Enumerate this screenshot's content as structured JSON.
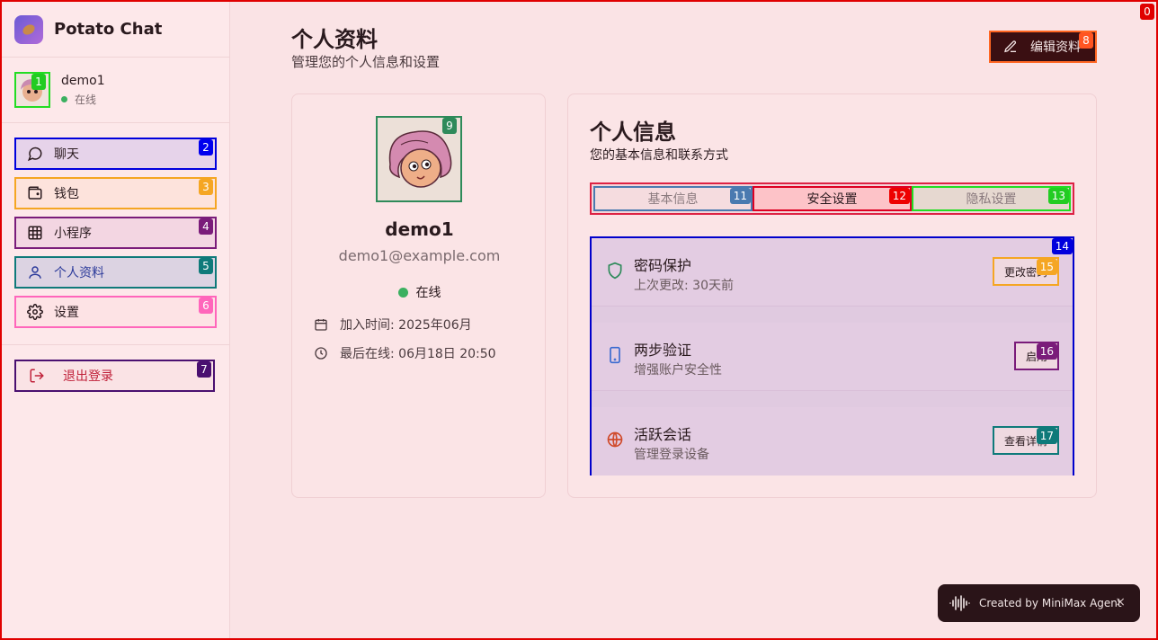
{
  "app": {
    "name": "Potato Chat"
  },
  "sidebar": {
    "user": {
      "name": "demo1",
      "status": "在线"
    },
    "items": [
      {
        "label": "聊天",
        "icon": "chat-bubble-icon"
      },
      {
        "label": "钱包",
        "icon": "wallet-icon"
      },
      {
        "label": "小程序",
        "icon": "grid-icon"
      },
      {
        "label": "个人资料",
        "icon": "user-icon"
      },
      {
        "label": "设置",
        "icon": "gear-icon"
      }
    ],
    "logout_label": "退出登录"
  },
  "header": {
    "title": "个人资料",
    "subtitle": "管理您的个人信息和设置",
    "edit_label": "编辑资料"
  },
  "profile": {
    "name": "demo1",
    "email": "demo1@example.com",
    "status": "在线",
    "joined": "加入时间: 2025年06月",
    "last_online": "最后在线: 06月18日 20:50"
  },
  "info": {
    "title": "个人信息",
    "subtitle": "您的基本信息和联系方式",
    "tabs": [
      "基本信息",
      "安全设置",
      "隐私设置"
    ],
    "active_tab": "安全设置",
    "security_items": [
      {
        "title": "密码保护",
        "desc": "上次更改: 30天前",
        "action": "更改密码",
        "icon": "shield-icon",
        "icon_color": "#2e8a5a"
      },
      {
        "title": "两步验证",
        "desc": "增强账户安全性",
        "action": "启用",
        "icon": "phone-icon",
        "icon_color": "#3a6ad0"
      },
      {
        "title": "活跃会话",
        "desc": "管理登录设备",
        "action": "查看详情",
        "icon": "globe-icon",
        "icon_color": "#d04a2a"
      }
    ]
  },
  "badges": [
    "0",
    "1",
    "2",
    "3",
    "4",
    "5",
    "6",
    "7",
    "8",
    "9",
    "11",
    "12",
    "13",
    "14",
    "15",
    "16",
    "17"
  ],
  "toast": {
    "text": "Created by MiniMax Agent",
    "close": "×"
  },
  "colors": {
    "accent": "#3a0f12",
    "online": "#3bb060",
    "danger": "#c0223a"
  }
}
